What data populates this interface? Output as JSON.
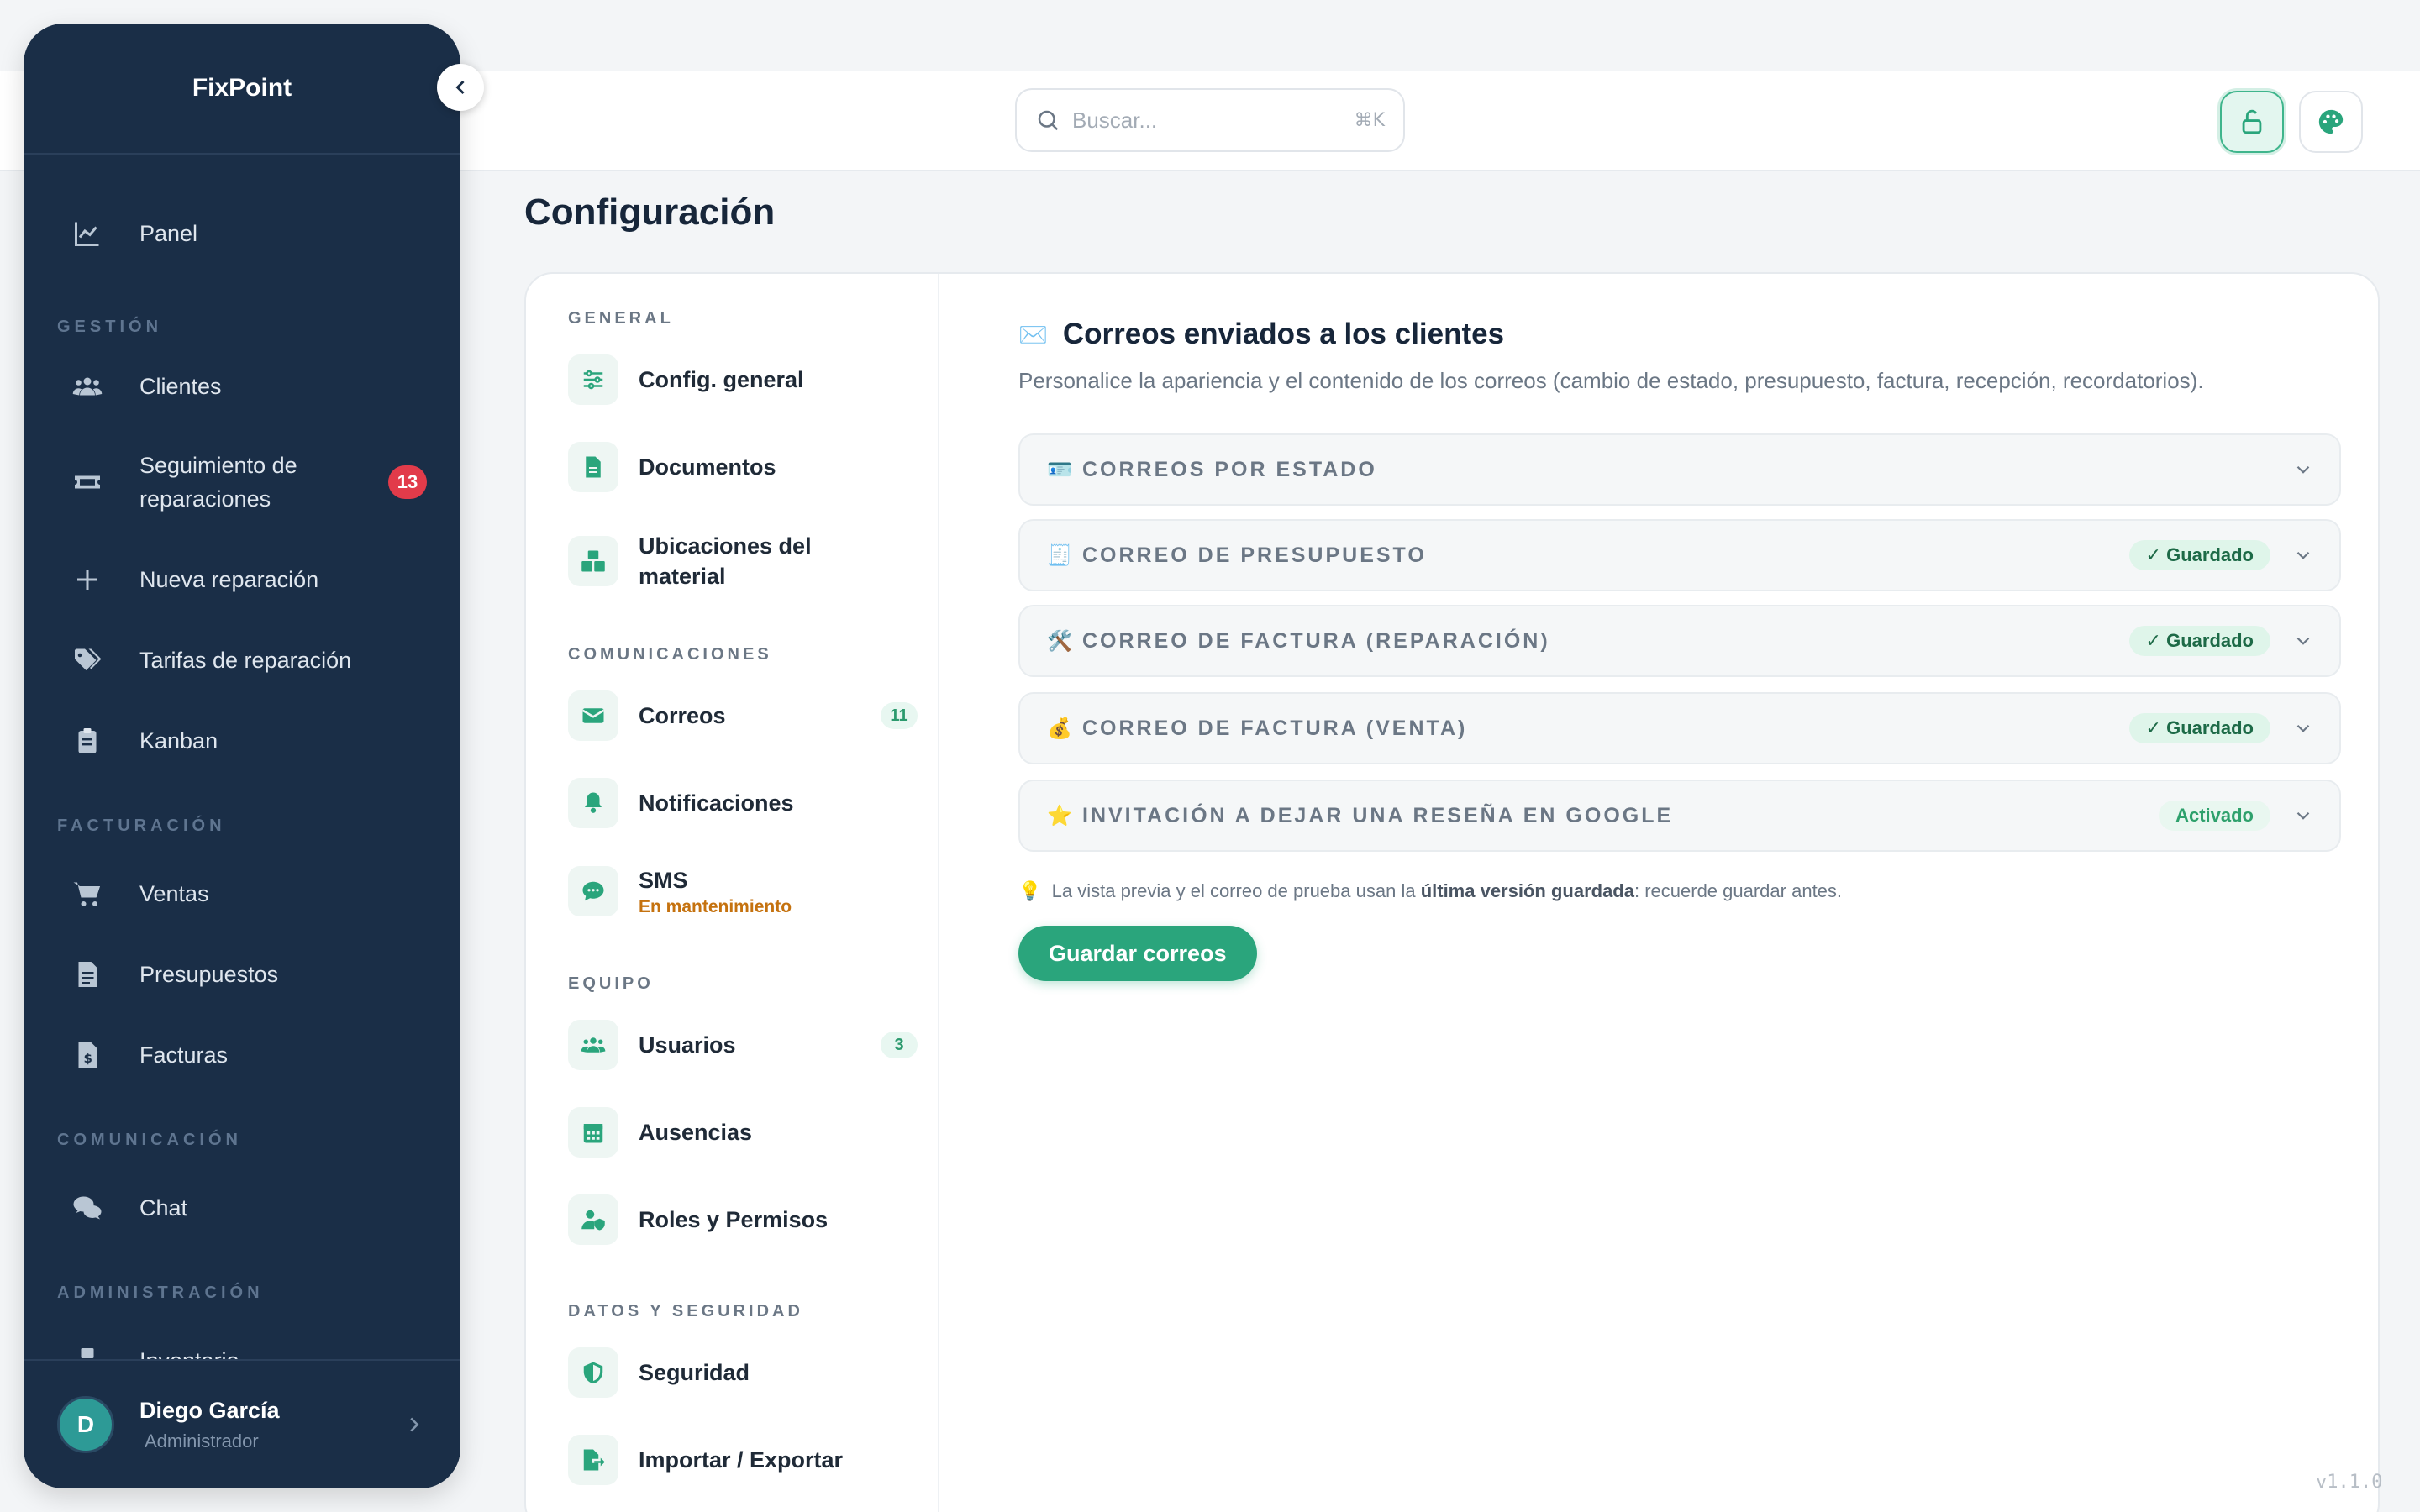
{
  "brand": {
    "name": "FixPoint"
  },
  "search": {
    "placeholder": "Buscar...",
    "shortcut": "⌘K"
  },
  "sidebar": {
    "items": [
      {
        "label": "Panel",
        "icon": "chart-line-icon"
      },
      {
        "label": "Clientes",
        "icon": "users-icon"
      },
      {
        "label": "Seguimiento de reparaciones",
        "icon": "ticket-icon",
        "badge": "13"
      },
      {
        "label": "Nueva reparación",
        "icon": "plus-icon"
      },
      {
        "label": "Tarifas de reparación",
        "icon": "tags-icon"
      },
      {
        "label": "Kanban",
        "icon": "clipboard-icon"
      },
      {
        "label": "Ventas",
        "icon": "cart-icon"
      },
      {
        "label": "Presupuestos",
        "icon": "document-icon"
      },
      {
        "label": "Facturas",
        "icon": "invoice-icon"
      },
      {
        "label": "Chat",
        "icon": "chat-icon"
      },
      {
        "label": "Inventario",
        "icon": "boxes-icon"
      }
    ],
    "sections": [
      "GESTIÓN",
      "FACTURACIÓN",
      "COMUNICACIÓN",
      "ADMINISTRACIÓN"
    ]
  },
  "user": {
    "initial": "D",
    "name": "Diego García",
    "role": "Administrador"
  },
  "page": {
    "title": "Configuración"
  },
  "settings_nav": {
    "sections": [
      "GENERAL",
      "COMUNICACIONES",
      "EQUIPO",
      "DATOS Y SEGURIDAD"
    ],
    "items": [
      {
        "label": "Config. general"
      },
      {
        "label": "Documentos"
      },
      {
        "label": "Ubicaciones del material"
      },
      {
        "label": "Correos",
        "count": "11"
      },
      {
        "label": "Notificaciones"
      },
      {
        "label": "SMS",
        "sub": "En mantenimiento"
      },
      {
        "label": "Usuarios",
        "count": "3"
      },
      {
        "label": "Ausencias"
      },
      {
        "label": "Roles y Permisos"
      },
      {
        "label": "Seguridad"
      },
      {
        "label": "Importar / Exportar"
      }
    ]
  },
  "content": {
    "title_icon": "✉️",
    "title": "Correos enviados a los clientes",
    "description": "Personalice la apariencia y el contenido de los correos (cambio de estado, presupuesto, factura, recepción, recordatorios).",
    "accordions": [
      {
        "emoji": "🪪",
        "title": "CORREOS POR ESTADO"
      },
      {
        "emoji": "🧾",
        "title": "CORREO DE PRESUPUESTO",
        "status": "✓ Guardado"
      },
      {
        "emoji": "🛠️",
        "title": "CORREO DE FACTURA (REPARACIÓN)",
        "status": "✓ Guardado"
      },
      {
        "emoji": "💰",
        "title": "CORREO DE FACTURA (VENTA)",
        "status": "✓ Guardado"
      },
      {
        "emoji": "⭐",
        "title": "INVITACIÓN A DEJAR UNA RESEÑA EN GOOGLE",
        "status": "Activado"
      }
    ],
    "hint_icon": "💡",
    "hint_pre": "La vista previa y el correo de prueba usan la ",
    "hint_bold": "última versión guardada",
    "hint_post": ": recuerde guardar antes.",
    "save_label": "Guardar correos"
  },
  "version": "v1.1.0",
  "colors": {
    "sidebar": "#1a2e47",
    "accent": "#2aa57c",
    "badge": "#e23b4a"
  }
}
